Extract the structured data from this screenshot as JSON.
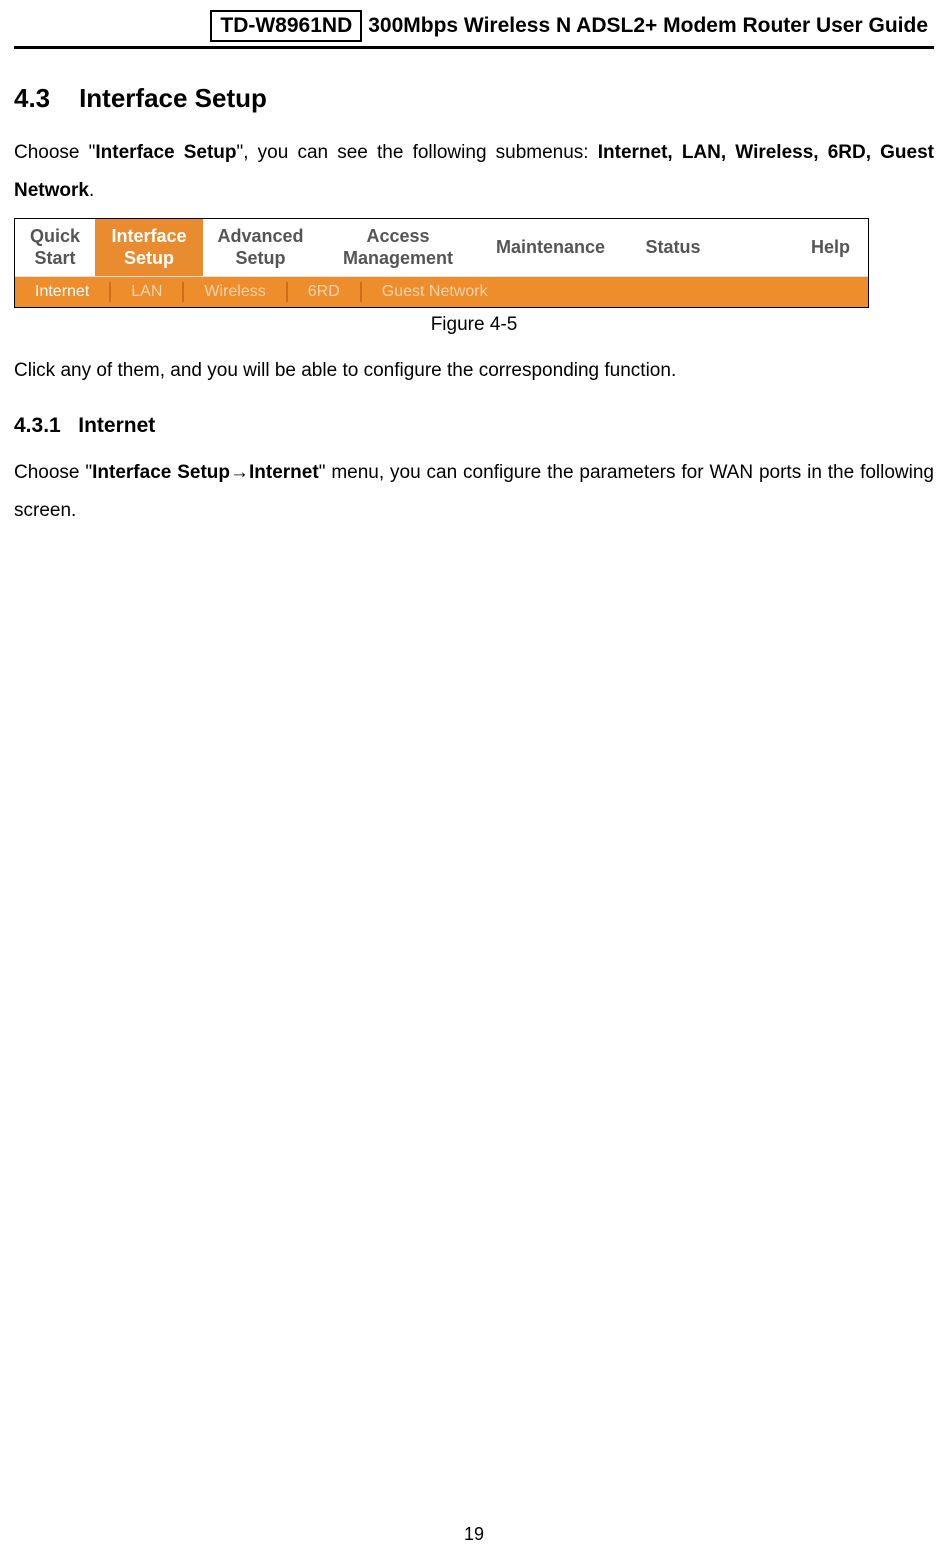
{
  "header": {
    "model": "TD-W8961ND",
    "title": "300Mbps Wireless N ADSL2+ Modem Router User Guide"
  },
  "section": {
    "number": "4.3",
    "title": "Interface Setup",
    "intro_pre": "Choose \"",
    "intro_bold1": "Interface Setup",
    "intro_mid": "\", you can see the following submenus: ",
    "intro_bold2": "Internet, LAN, Wireless, 6RD, Guest Network",
    "intro_post": "."
  },
  "nav": {
    "main": [
      {
        "label": "Quick\nStart",
        "cls": "quick"
      },
      {
        "label": "Interface\nSetup",
        "cls": "interface"
      },
      {
        "label": "Advanced\nSetup",
        "cls": "advanced"
      },
      {
        "label": "Access\nManagement",
        "cls": "access"
      },
      {
        "label": "Maintenance",
        "cls": "maintenance"
      },
      {
        "label": "Status",
        "cls": "status"
      },
      {
        "label": "Help",
        "cls": "help"
      }
    ],
    "sub": [
      {
        "label": "Internet",
        "cls": "sel"
      },
      {
        "label": "LAN",
        "cls": "dim"
      },
      {
        "label": "Wireless",
        "cls": "dim"
      },
      {
        "label": "6RD",
        "cls": "dim"
      },
      {
        "label": "Guest Network",
        "cls": "dim"
      }
    ]
  },
  "figure_caption": "Figure 4-5",
  "after_figure": "Click any of them, and you will be able to configure the corresponding function.",
  "subsection": {
    "number": "4.3.1",
    "title": "Internet",
    "p_pre": "Choose \"",
    "p_bold1": "Interface Setup",
    "p_arrow": "→",
    "p_bold2": "Internet",
    "p_post": "\" menu, you can configure the parameters for WAN ports in the following screen."
  },
  "page_number": "19"
}
